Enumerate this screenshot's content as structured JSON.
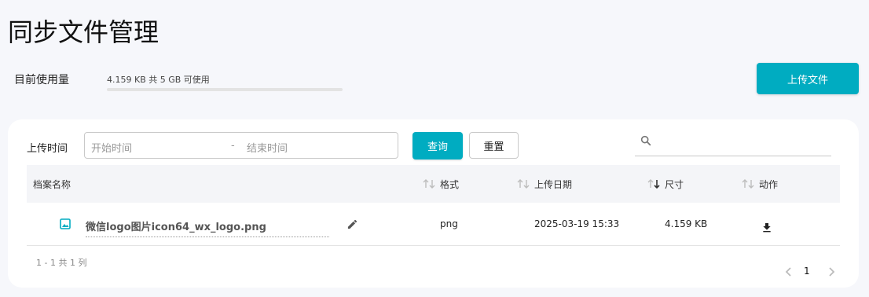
{
  "page": {
    "title": "同步文件管理"
  },
  "usage": {
    "label": "目前使用量",
    "text": "4.159 KB 共 5 GB 可使用",
    "fraction": 1e-06
  },
  "actions": {
    "upload_label": "上传文件"
  },
  "filter": {
    "label": "上传时间",
    "start_placeholder": "开始时间",
    "separator": "-",
    "end_placeholder": "结束时间",
    "query_label": "查询",
    "reset_label": "重置",
    "search_value": ""
  },
  "table": {
    "headers": {
      "name": "档案名称",
      "format": "格式",
      "date": "上传日期",
      "size": "尺寸",
      "action": "动作"
    },
    "rows": [
      {
        "name": "微信logo图片icon64_wx_logo.png",
        "format": "png",
        "date": "2025-03-19 15:33",
        "size": "4.159 KB"
      }
    ]
  },
  "pagination": {
    "info": "1 - 1 共 1 列",
    "page": "1"
  },
  "colors": {
    "accent": "#00acc1"
  },
  "icons": [
    "search-icon",
    "sort-icon",
    "sort-desc-icon",
    "image-file-icon",
    "edit-icon",
    "download-icon",
    "chevron-left-icon",
    "chevron-right-icon"
  ]
}
